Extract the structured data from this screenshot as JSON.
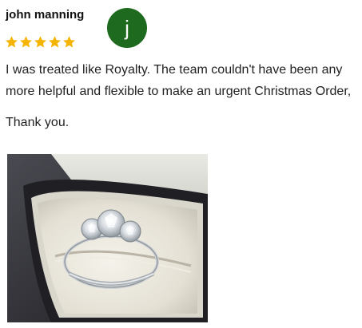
{
  "review": {
    "reviewer_name": "john manning",
    "avatar_letter": "j",
    "avatar_color": "#1e6b1f",
    "rating": 5,
    "rating_max": 5,
    "star_color": "#f4b400",
    "text": "I was treated like Royalty. The team couldn't have been any more helpful and flexible to make an urgent  Christmas Order,",
    "signoff": "Thank you."
  }
}
